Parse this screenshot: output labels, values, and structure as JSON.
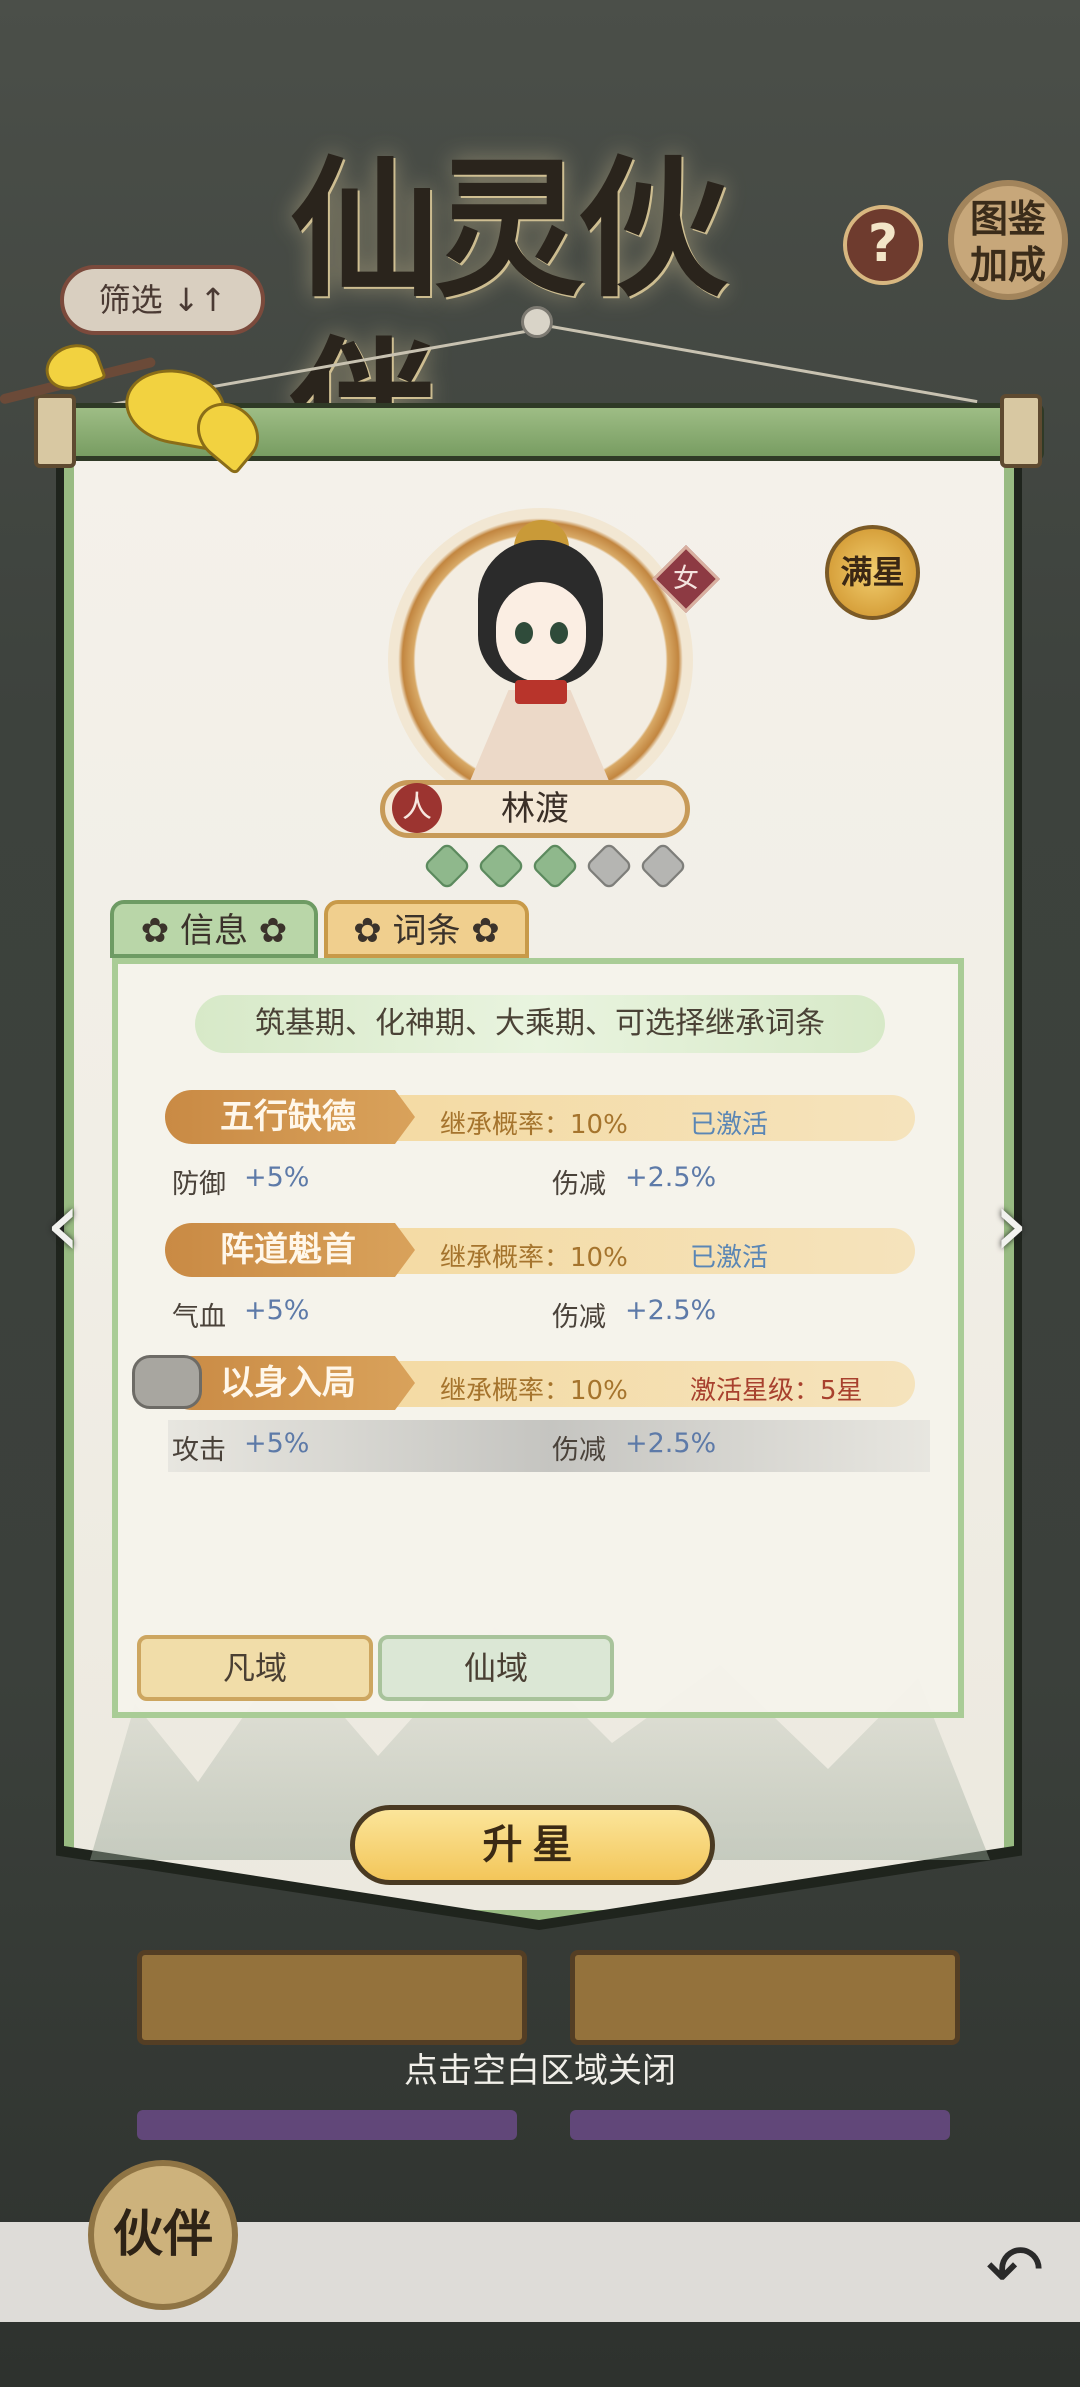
{
  "header": {
    "title": "仙灵伙伴",
    "help_label": "?",
    "atlas_label": "图鉴\n加成",
    "filter_label": "筛选 ↓↑"
  },
  "partner": {
    "gender": "女",
    "max_star_badge": "满星",
    "race": "人",
    "name": "林渡",
    "stars_total": 5,
    "stars_lit": 3
  },
  "tabs": {
    "info": "✿ 信息 ✿",
    "traits": "✿ 词条 ✿",
    "active": "traits"
  },
  "traits_panel": {
    "banner": "筑基期、化神期、大乘期、可选择继承词条",
    "traits": [
      {
        "name": "五行缺德",
        "rate": "继承概率：10%",
        "status": "已激活",
        "status_color": "#5a86b5",
        "stat1_label": "防御",
        "stat1_value": "+5%",
        "stat2_label": "伤减",
        "stat2_value": "+2.5%",
        "locked": false
      },
      {
        "name": "阵道魁首",
        "rate": "继承概率：10%",
        "status": "已激活",
        "status_color": "#5a86b5",
        "stat1_label": "气血",
        "stat1_value": "+5%",
        "stat2_label": "伤减",
        "stat2_value": "+2.5%",
        "locked": false
      },
      {
        "name": "以身入局",
        "rate": "继承概率：10%",
        "status": "激活星级：5星",
        "status_color": "#a8412e",
        "stat1_label": "攻击",
        "stat1_value": "+5%",
        "stat2_label": "伤减",
        "stat2_value": "+2.5%",
        "locked": true
      }
    ],
    "realm_tabs": [
      "凡域",
      "仙域"
    ],
    "active_realm": "凡域"
  },
  "actions": {
    "upgrade_label": "升星",
    "close_hint": "点击空白区域关闭"
  },
  "nav": {
    "prev_arrow": "‹",
    "next_arrow": "›",
    "bottom_logo": "伙伴",
    "back_icon": "↶"
  },
  "colors": {
    "panel_border": "#98bb82",
    "accent_gold": "#d7a13c",
    "active_status": "#5a86b5",
    "locked_status": "#a8412e"
  }
}
